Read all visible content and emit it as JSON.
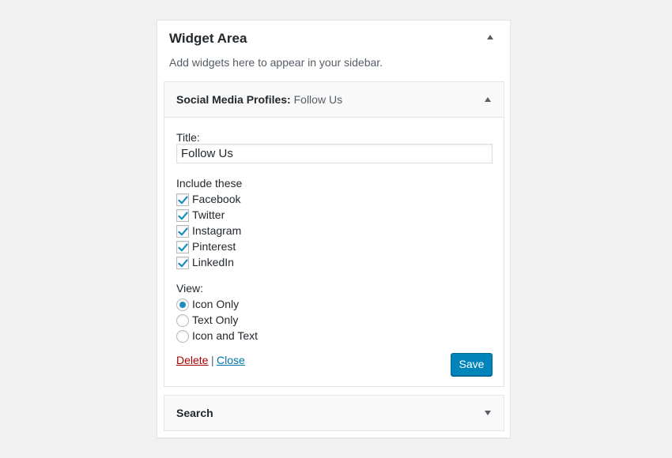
{
  "widget_area": {
    "title": "Widget Area",
    "description": "Add widgets here to appear in your sidebar."
  },
  "social_widget": {
    "name": "Social Media Profiles:",
    "in_title": "Follow Us",
    "title_label": "Title:",
    "title_value": "Follow Us",
    "include_label": "Include these",
    "networks": [
      {
        "label": "Facebook",
        "checked": true
      },
      {
        "label": "Twitter",
        "checked": true
      },
      {
        "label": "Instagram",
        "checked": true
      },
      {
        "label": "Pinterest",
        "checked": true
      },
      {
        "label": "LinkedIn",
        "checked": true
      }
    ],
    "view_label": "View:",
    "view_options": [
      {
        "label": "Icon Only",
        "selected": true
      },
      {
        "label": "Text Only",
        "selected": false
      },
      {
        "label": "Icon and Text",
        "selected": false
      }
    ],
    "delete_label": "Delete",
    "separator": "|",
    "close_label": "Close",
    "save_label": "Save"
  },
  "search_widget": {
    "name": "Search"
  },
  "colors": {
    "accent": "#0085ba",
    "check": "#1e8cbe",
    "delete": "#aa0000",
    "link": "#0073aa"
  }
}
